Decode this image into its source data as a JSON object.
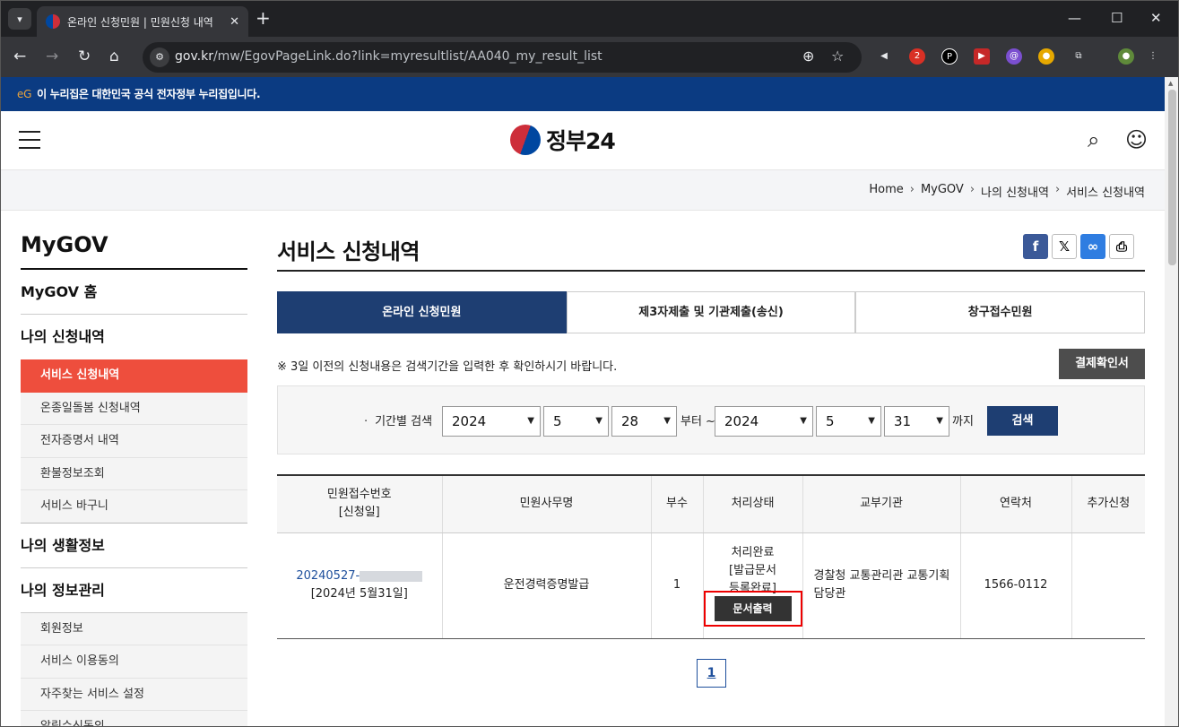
{
  "browser": {
    "tab_title": "온라인 신청민원 | 민원신청 내역",
    "url_prefix": "gov.kr",
    "url_path": "/mw/EgovPageLink.do?link=myresultlist/AA040_my_result_list",
    "extension_badge": "2"
  },
  "banner": {
    "logo": "eG",
    "text": "이 누리집은 대한민국 공식 전자정부 누리집입니다."
  },
  "header": {
    "logo_text": "정부24"
  },
  "breadcrumb": [
    "Home",
    "MyGOV",
    "나의 신청내역",
    "서비스 신청내역"
  ],
  "sidebar": {
    "title": "MyGOV",
    "home": "MyGOV 홈",
    "section1": "나의 신청내역",
    "sub1": [
      "서비스 신청내역",
      "온종일돌봄 신청내역",
      "전자증명서 내역",
      "환불정보조회",
      "서비스 바구니"
    ],
    "section2": "나의 생활정보",
    "section3": "나의 정보관리",
    "sub3": [
      "회원정보",
      "서비스 이용동의",
      "자주찾는 서비스 설정",
      "알림수신동의"
    ]
  },
  "main": {
    "title": "서비스 신청내역",
    "tabs": [
      "온라인 신청민원",
      "제3자제출 및 기관제출(송신)",
      "창구접수민원"
    ],
    "notice": "※ 3일 이전의 신청내용은 검색기간을 입력한 후 확인하시기 바랍니다.",
    "pay_button": "결제확인서",
    "search": {
      "label": "ㆍ 기간별 검색",
      "from_year": "2024",
      "from_month": "5",
      "from_day": "28",
      "between": "부터 ~",
      "to_year": "2024",
      "to_month": "5",
      "to_day": "31",
      "until": "까지",
      "button": "검색"
    },
    "table": {
      "headers": [
        "민원접수번호",
        "[신청일]",
        "민원사무명",
        "부수",
        "처리상태",
        "교부기관",
        "연락처",
        "추가신청"
      ],
      "row": {
        "receipt_no": "20240527-",
        "date": "[2024년 5월31일]",
        "service": "운전경력증명발급",
        "copies": "1",
        "status_lines": [
          "처리완료",
          "[발급문서",
          "등록완료]"
        ],
        "print_button": "문서출력",
        "agency": "경찰청 교통관리관 교통기획담당관",
        "phone": "1566-0112"
      }
    },
    "page": "1"
  }
}
